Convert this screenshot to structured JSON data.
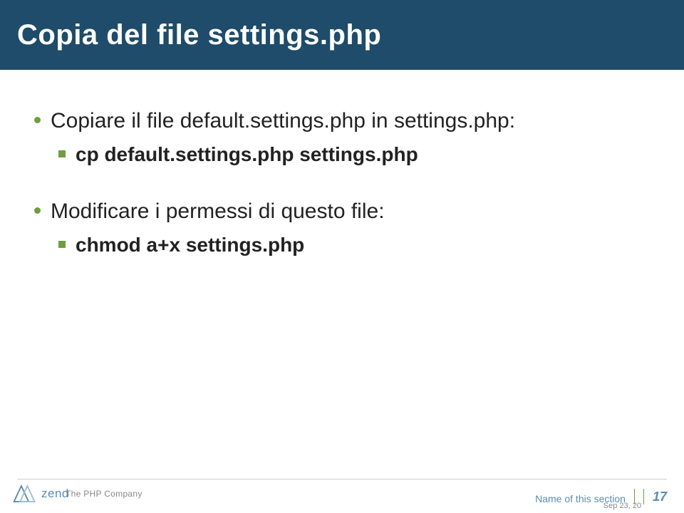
{
  "title": "Copia del file settings.php",
  "content": {
    "b1": "Copiare il file default.settings.php in settings.php:",
    "b1_sub": "cp default.settings.php settings.php",
    "b2": "Modificare i permessi di questo file:",
    "b2_sub": "chmod a+x settings.php"
  },
  "footer": {
    "brand": "zend",
    "tagline": "The PHP Company",
    "section": "Name of this section",
    "page": "17",
    "date_cut": "Sep 23, 20"
  }
}
